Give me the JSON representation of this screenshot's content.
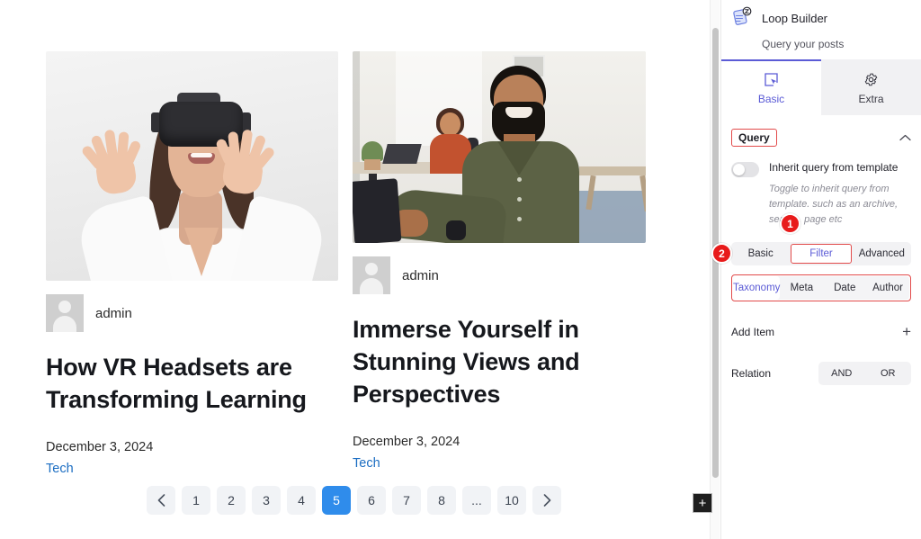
{
  "canvas": {
    "posts": [
      {
        "image_alt": "woman-wearing-vr-headset-reaching-forward",
        "author": "admin",
        "title": "How VR Headsets are Transforming Learning",
        "date": "December 3, 2024",
        "category": "Tech"
      },
      {
        "image_alt": "smiling-bearded-man-at-office-desk",
        "author": "admin",
        "title": "Immerse Yourself in Stunning Views and Perspectives",
        "date": "December 3, 2024",
        "category": "Tech"
      }
    ],
    "pagination": {
      "prev_label": "‹",
      "next_label": "›",
      "pages": [
        "1",
        "2",
        "3",
        "4",
        "5",
        "6",
        "7",
        "8",
        "...",
        "10"
      ],
      "current": "5",
      "active_color": "#2f8ceb"
    },
    "add_block_label": "+"
  },
  "panel": {
    "header": {
      "icon": "loop-builder-icon",
      "title": "Loop Builder",
      "subtitle": "Query your posts"
    },
    "main_tabs": [
      {
        "label": "Basic",
        "icon": "cursor-select-icon",
        "active": true
      },
      {
        "label": "Extra",
        "icon": "gear-icon",
        "active": false
      }
    ],
    "query": {
      "section_label": "Query",
      "collapse_icon": "chevron-up-icon",
      "inherit": {
        "label": "Inherit query from template",
        "description": "Toggle to inherit query from template. such as an archive, search, page etc",
        "enabled": false
      },
      "level_tabs": [
        {
          "label": "Basic",
          "active": false,
          "highlighted": false
        },
        {
          "label": "Filter",
          "active": true,
          "highlighted": true
        },
        {
          "label": "Advanced",
          "active": false,
          "highlighted": false
        }
      ],
      "sub_tabs": [
        {
          "label": "Taxonomy",
          "active": true
        },
        {
          "label": "Meta",
          "active": false
        },
        {
          "label": "Date",
          "active": false
        },
        {
          "label": "Author",
          "active": false
        }
      ],
      "add_item": {
        "label": "Add Item",
        "button_label": "+"
      },
      "relation": {
        "label": "Relation",
        "options": [
          "AND",
          "OR"
        ]
      }
    }
  },
  "annotations": {
    "badges": [
      {
        "number": "1",
        "target": "filter-tab"
      },
      {
        "number": "2",
        "target": "taxonomy-sub-tabs"
      }
    ],
    "highlight_color": "#e24b4b",
    "accent_color": "#5b5bd6"
  }
}
